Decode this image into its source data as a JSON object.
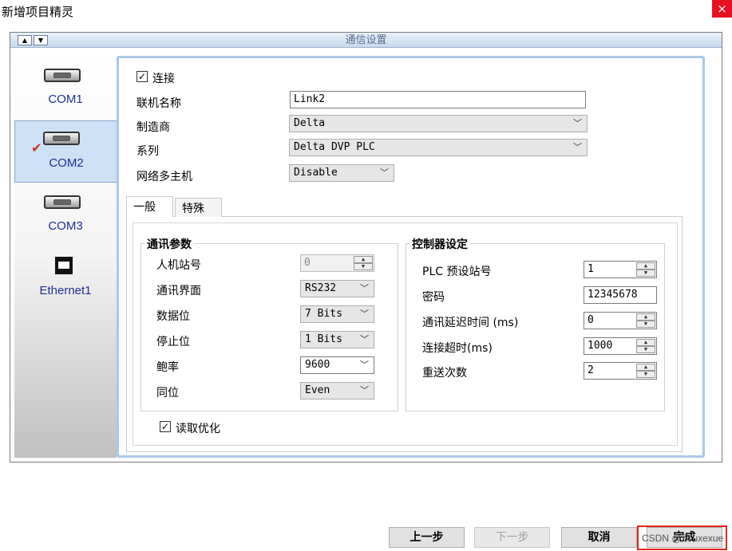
{
  "window": {
    "title": "新增项目精灵",
    "close_icon": "×"
  },
  "header": {
    "title": "通信设置",
    "up_arrow": "▲",
    "down_arrow": "▼"
  },
  "ports": [
    {
      "label": "COM1",
      "icon": "serial-port-icon",
      "selected": false
    },
    {
      "label": "COM2",
      "icon": "serial-port-icon",
      "selected": true
    },
    {
      "label": "COM3",
      "icon": "serial-port-icon",
      "selected": false
    },
    {
      "label": "Ethernet1",
      "icon": "ethernet-port-icon",
      "selected": false
    }
  ],
  "selected_marker": "✔",
  "connection": {
    "connect_label": "连接",
    "connect_checked": true,
    "link_name_label": "联机名称",
    "link_name_value": "Link2",
    "manufacturer_label": "制造商",
    "manufacturer_value": "Delta",
    "series_label": "系列",
    "series_value": "Delta DVP PLC",
    "multi_master_label": "网络多主机",
    "multi_master_value": "Disable"
  },
  "tabs": [
    {
      "label": "一般",
      "active": true
    },
    {
      "label": "特殊",
      "active": false
    }
  ],
  "comm_params": {
    "title": "通讯参数",
    "hmi_station_label": "人机站号",
    "hmi_station_value": "0",
    "interface_label": "通讯界面",
    "interface_value": "RS232",
    "data_bits_label": "数据位",
    "data_bits_value": "7 Bits",
    "stop_bits_label": "停止位",
    "stop_bits_value": "1 Bits",
    "baud_label": "鲍率",
    "baud_value": "9600",
    "parity_label": "同位",
    "parity_value": "Even"
  },
  "controller": {
    "title": "控制器设定",
    "plc_station_label": "PLC 预设站号",
    "plc_station_value": "1",
    "password_label": "密码",
    "password_value": "12345678",
    "delay_label": "通讯延迟时间 (ms)",
    "delay_value": "0",
    "timeout_label": "连接超时(ms)",
    "timeout_value": "1000",
    "retry_label": "重送次数",
    "retry_value": "2"
  },
  "read_opt": {
    "label": "读取优化",
    "checked": true
  },
  "buttons": {
    "back": "上一步",
    "next": "下一步",
    "cancel": "取消",
    "finish": "完成"
  },
  "watermark": "CSDN @Zouxexue",
  "colors": {
    "accent_blue": "#aac8e6",
    "port_label": "#1f2f96",
    "highlight_red": "#e0261e",
    "check_red": "#d2312b"
  }
}
